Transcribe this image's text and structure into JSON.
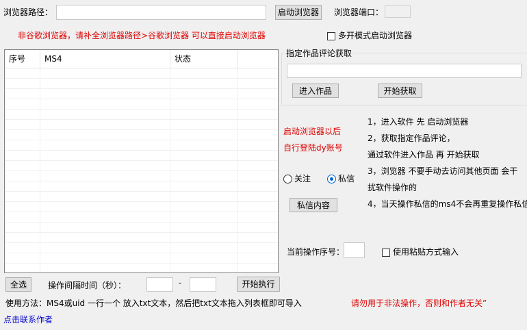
{
  "top": {
    "path_label": "浏览器路径：",
    "path_value": "",
    "launch_button": "启动浏览器",
    "port_label": "浏览器端口：",
    "port_value": ""
  },
  "warning_text": "非谷歌浏览器，请补全浏览器路径>谷歌浏览器 可以直接启动浏览器",
  "multi_mode_label": "多开模式启动浏览器",
  "list": {
    "columns": [
      "序号",
      "MS4",
      "状态"
    ]
  },
  "work_group": {
    "title": "指定作品评论获取",
    "url_value": "",
    "enter_button": "进入作品",
    "start_fetch_button": "开始获取"
  },
  "login_hint_line1": "启动浏览器以后",
  "login_hint_line2": "自行登陆dy账号",
  "mode": {
    "follow_label": "关注",
    "message_label": "私信",
    "selected": "私信"
  },
  "message_content_button": "私信内容",
  "instructions": [
    "1，进入软件 先 启动浏览器",
    "2，获取指定作品评论，",
    "通过软件进入作品 再 开始获取",
    "3，浏览器 不要手动去访问其他页面 会干",
    "扰软件操作的",
    "4，当天操作私信的ms4不会再重复操作私信"
  ],
  "current_seq_label": "当前操作序号：",
  "current_seq_value": "",
  "paste_mode_label": "使用粘贴方式输入",
  "bottom": {
    "select_all_button": "全选",
    "interval_label": "操作间隔时间（秒）：",
    "interval_from": "",
    "interval_dash": "-",
    "interval_to": "",
    "start_button": "开始执行"
  },
  "usage_text": "使用方法：MS4或uid 一行一个 放入txt文本，然后把txt文本拖入列表框即可导入",
  "legal_text": "请勿用于非法操作，否则和作者无关”",
  "contact_link": "点击联系作者"
}
